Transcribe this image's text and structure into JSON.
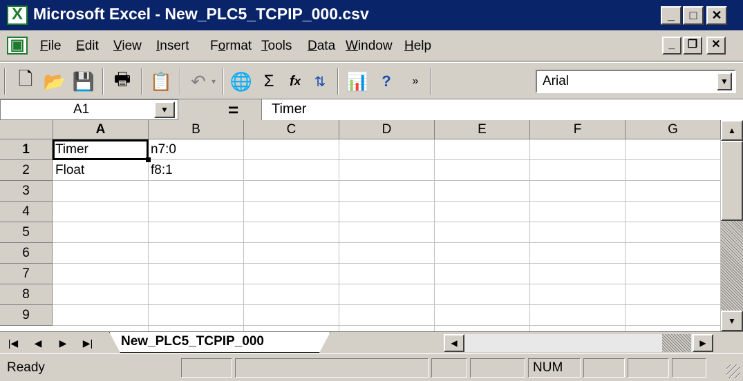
{
  "window": {
    "title": "Microsoft Excel - New_PLC5_TCPIP_000.csv",
    "icon": "excel-icon"
  },
  "menu": [
    {
      "label": "File",
      "hotkey": "F",
      "rest": "ile"
    },
    {
      "label": "Edit",
      "hotkey": "E",
      "rest": "dit"
    },
    {
      "label": "View",
      "hotkey": "V",
      "rest": "iew"
    },
    {
      "label": "Insert",
      "hotkey": "I",
      "rest": "nsert"
    },
    {
      "label": "Format",
      "pre": "F",
      "hotkey": "o",
      "rest": "rmat"
    },
    {
      "label": "Tools",
      "hotkey": "T",
      "rest": "ools"
    },
    {
      "label": "Data",
      "hotkey": "D",
      "rest": "ata"
    },
    {
      "label": "Window",
      "hotkey": "W",
      "rest": "indow"
    },
    {
      "label": "Help",
      "hotkey": "H",
      "rest": "elp"
    }
  ],
  "toolbar": {
    "icons": [
      "new-icon",
      "open-icon",
      "save-icon",
      "print-icon",
      "paste-icon",
      "undo-icon",
      "web-icon",
      "autosum-icon",
      "function-icon",
      "sort-ascending-icon",
      "chart-wizard-icon",
      "help-icon",
      "more-icon"
    ],
    "font": "Arial"
  },
  "formula_bar": {
    "name_box": "A1",
    "eq": "=",
    "formula": "Timer"
  },
  "grid": {
    "columns": [
      "A",
      "B",
      "C",
      "D",
      "E",
      "F",
      "G"
    ],
    "rows": [
      "1",
      "2",
      "3",
      "4",
      "5",
      "6",
      "7",
      "8",
      "9"
    ],
    "active_cell": "A1",
    "cells": [
      {
        "col": "A",
        "row": "1",
        "value": "Timer"
      },
      {
        "col": "B",
        "row": "1",
        "value": "n7:0"
      },
      {
        "col": "A",
        "row": "2",
        "value": "Float"
      },
      {
        "col": "B",
        "row": "2",
        "value": "f8:1"
      }
    ]
  },
  "sheet_tab": "New_PLC5_TCPIP_000",
  "status": {
    "text": "Ready",
    "num": "NUM"
  }
}
